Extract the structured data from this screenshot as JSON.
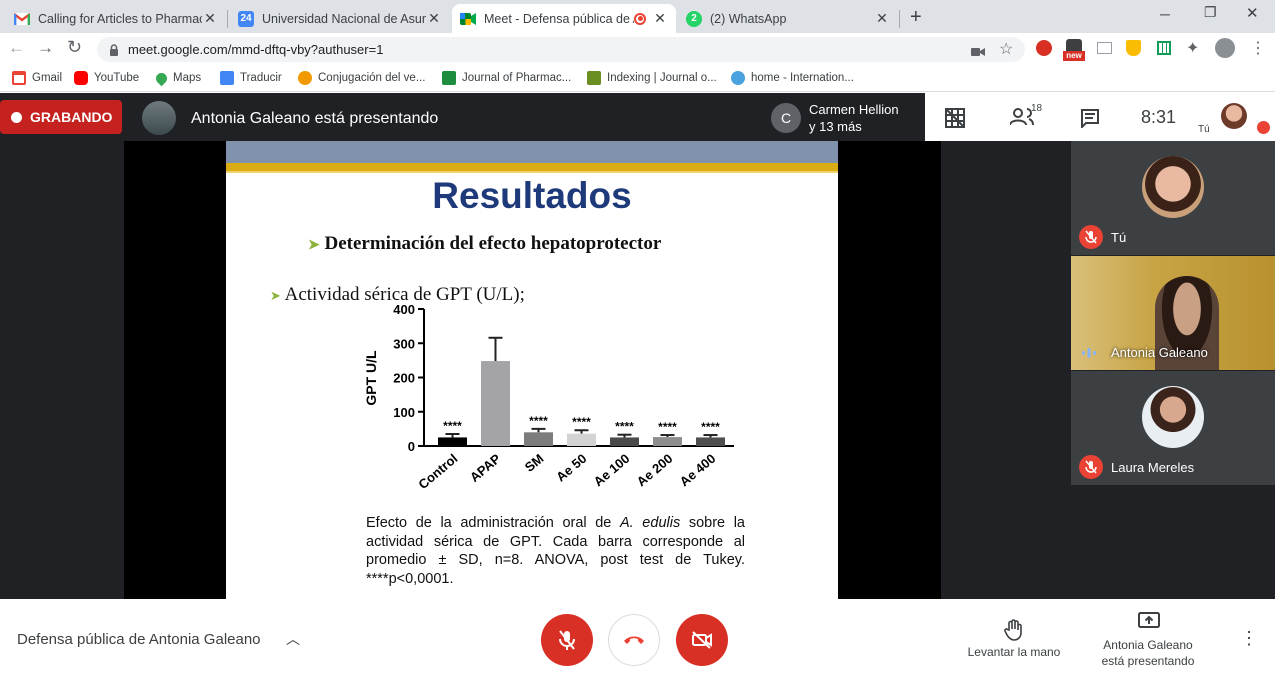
{
  "browser": {
    "tabs": [
      {
        "title": "Calling for Articles to Pharmaceu",
        "icon": "gmail-icon"
      },
      {
        "title": "Universidad Nacional de Asunció",
        "icon": "calendar-icon"
      },
      {
        "title": "Meet - Defensa pública de A",
        "icon": "meet-icon"
      },
      {
        "title": "(2) WhatsApp",
        "icon": "whatsapp-icon"
      }
    ],
    "whatsapp_badge": "2",
    "calendar_day": "24",
    "url": "meet.google.com/mmd-dftq-vby?authuser=1",
    "new_badge": "new",
    "bookmarks": [
      {
        "label": "Gmail",
        "icon": "gmail-icon"
      },
      {
        "label": "YouTube",
        "icon": "youtube-icon"
      },
      {
        "label": "Maps",
        "icon": "maps-pin-icon"
      },
      {
        "label": "Traducir",
        "icon": "translate-icon"
      },
      {
        "label": "Conjugación del ve...",
        "icon": "conjugation-icon"
      },
      {
        "label": "Journal of Pharmac...",
        "icon": "journal-icon"
      },
      {
        "label": "Indexing | Journal o...",
        "icon": "indexing-icon"
      },
      {
        "label": "home - Internation...",
        "icon": "globe-icon"
      }
    ]
  },
  "meet": {
    "recording_label": "GRABANDO",
    "presenter_banner": "Antonia Galeano está presentando",
    "others_avatar_letter": "C",
    "others_line1": "Carmen Hellion",
    "others_line2": "y 13 más",
    "participants_count": "18",
    "time": "8:31",
    "self_label": "Tú",
    "participants": [
      {
        "name": "Tú",
        "muted": true
      },
      {
        "name": "Antonia Galeano",
        "muted": false
      },
      {
        "name": "Laura Mereles",
        "muted": true
      }
    ],
    "meeting_title": "Defensa pública de Antonia Galeano",
    "raise_hand_label": "Levantar la mano",
    "presenting_line1": "Antonia Galeano",
    "presenting_line2": "está presentando",
    "colors": {
      "record": "#d93025",
      "end_call": "#ea4335",
      "accent_blue": "#1a73e8"
    }
  },
  "slide": {
    "title": "Resultados",
    "heading": "Determinación del efecto hepatoprotector",
    "subheading": "Actividad sérica de GPT (U/L);",
    "caption": [
      "Efecto de la administración oral de ",
      "A. edulis",
      " sobre la actividad sérica de GPT. Cada barra corresponde al promedio ± SD, n=8. ANOVA, post test de Tukey. ****p<0,0001."
    ],
    "colors": {
      "title": "#1f3a7a",
      "bullet": "#8db33a",
      "band_gold": "#d9ad13",
      "band_blue": "#8192ad"
    }
  },
  "chart_data": {
    "type": "bar",
    "categories": [
      "Control",
      "APAP",
      "SM",
      "Ae 50",
      "Ae 100",
      "Ae 200",
      "Ae 400"
    ],
    "values": [
      25,
      248,
      40,
      36,
      25,
      26,
      25
    ],
    "errors": [
      10,
      68,
      10,
      10,
      8,
      6,
      7
    ],
    "significance": [
      "****",
      "",
      "****",
      "****",
      "****",
      "****",
      "****"
    ],
    "bar_colors": [
      "#000000",
      "#a3a3a8",
      "#7c7c7c",
      "#d3d3d3",
      "#4a4a4a",
      "#8e8e8e",
      "#4f4f4f"
    ],
    "ylabel": "GPT U/L",
    "ylim": [
      0,
      400
    ],
    "yticks": [
      "0",
      "100",
      "200",
      "300",
      "400"
    ]
  }
}
